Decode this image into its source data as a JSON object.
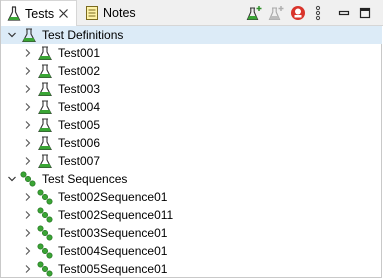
{
  "tabs": [
    {
      "label": "Tests",
      "active": true
    },
    {
      "label": "Notes",
      "active": false
    }
  ],
  "toolbar": {
    "buttons": [
      "add-test-icon",
      "add-test-disabled-icon",
      "stop-icon",
      "more-options-icon",
      "minimize-icon",
      "maximize-icon"
    ]
  },
  "tree": {
    "test_definitions": {
      "label": "Test Definitions",
      "expanded": true,
      "items": [
        "Test001",
        "Test002",
        "Test003",
        "Test004",
        "Test005",
        "Test006",
        "Test007"
      ]
    },
    "test_sequences": {
      "label": "Test Sequences",
      "expanded": true,
      "items": [
        "Test002Sequence01",
        "Test002Sequence011",
        "Test003Sequence01",
        "Test004Sequence01",
        "Test005Sequence01"
      ]
    }
  },
  "colors": {
    "selection": "#dcebf7",
    "flask_green": "#3aa535",
    "stop_red": "#d9342b"
  }
}
